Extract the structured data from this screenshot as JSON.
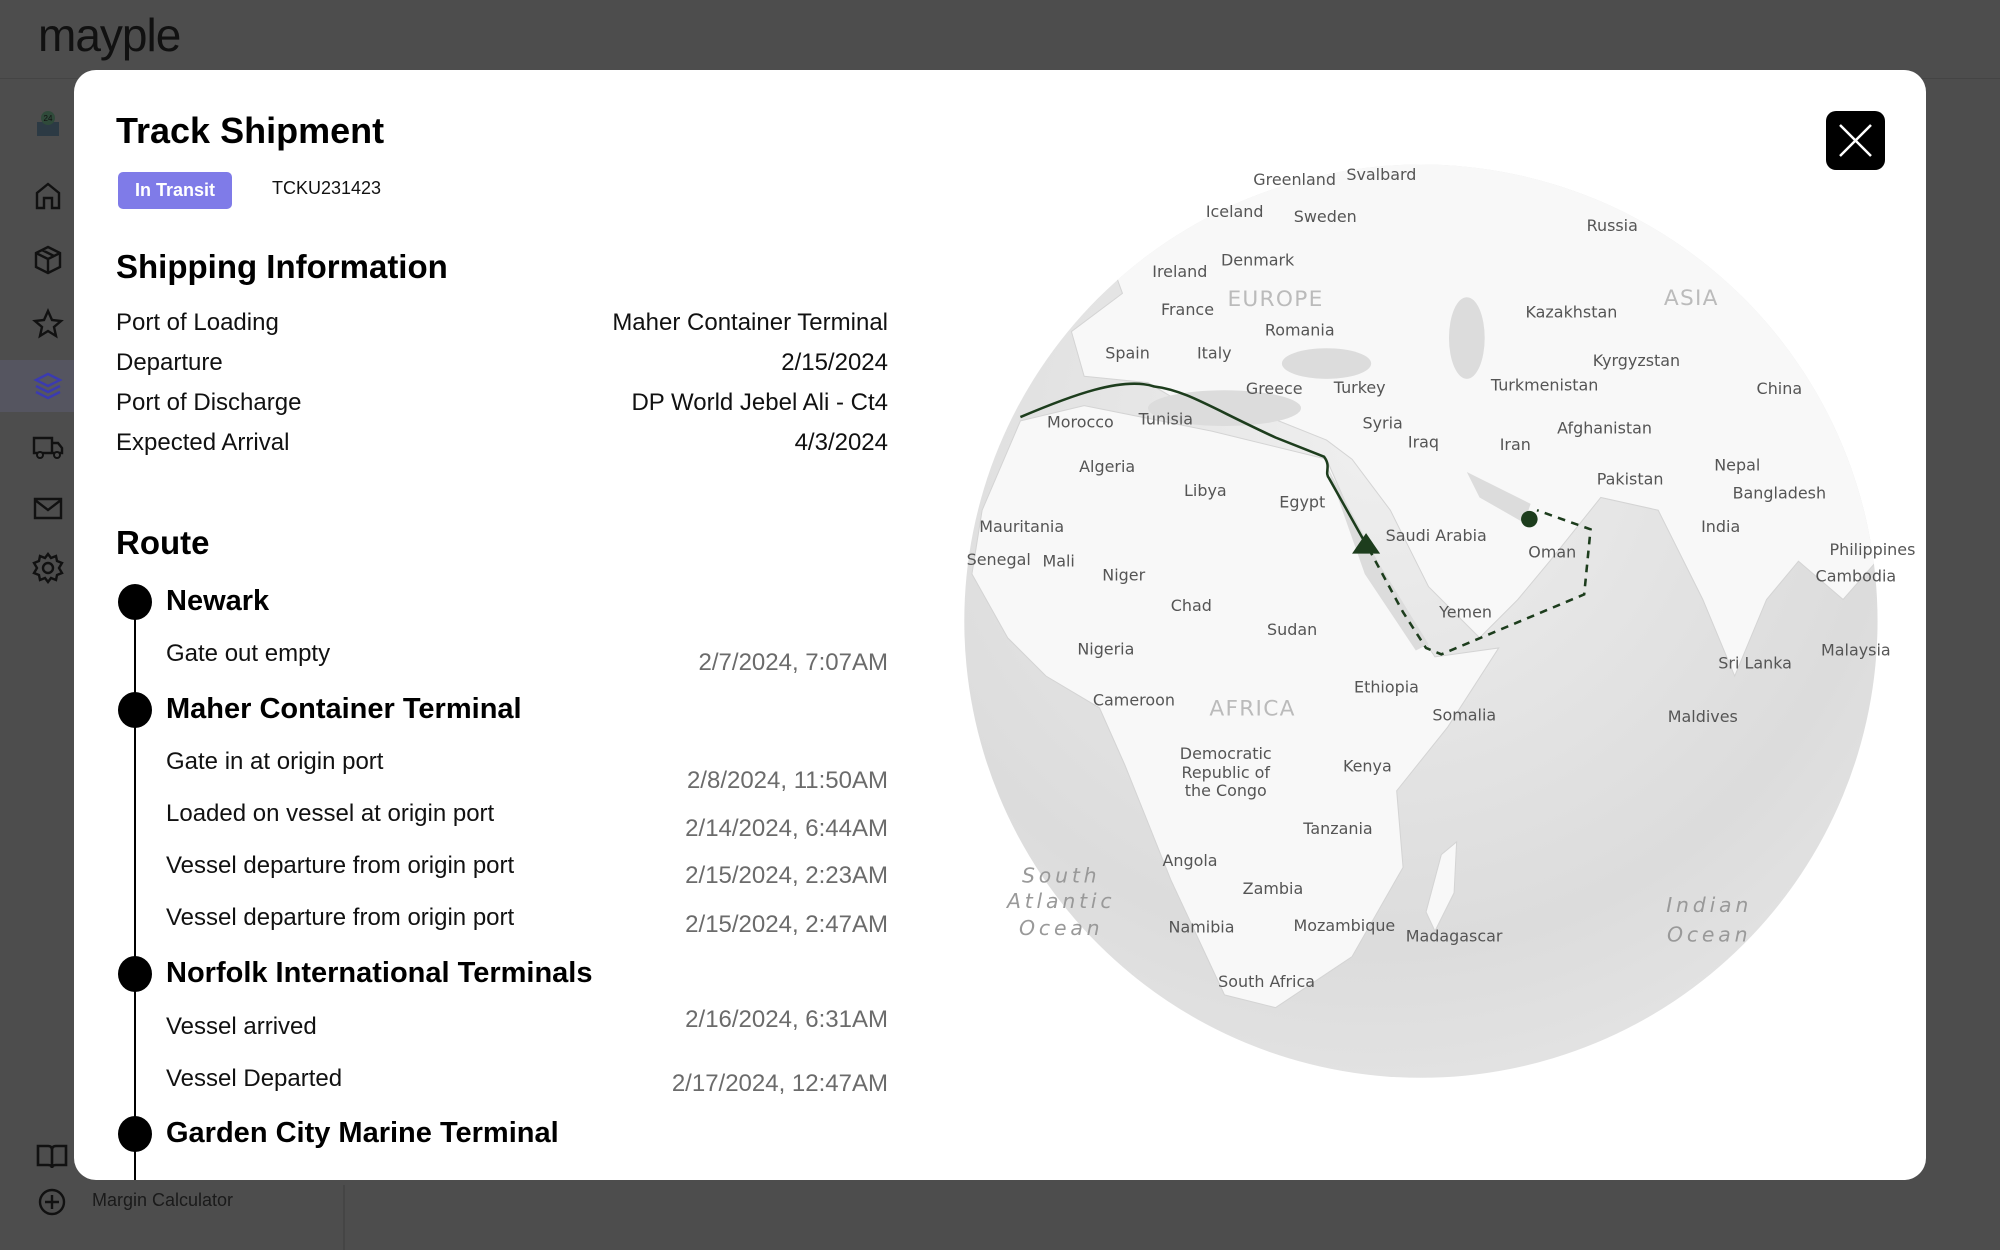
{
  "app": {
    "logo": "mayple"
  },
  "sidebar": {
    "items": [
      {
        "icon": "store-24-icon"
      },
      {
        "icon": "home-icon"
      },
      {
        "icon": "box-icon"
      },
      {
        "icon": "star-icon"
      },
      {
        "icon": "layers-icon",
        "active": true
      },
      {
        "icon": "truck-icon"
      },
      {
        "icon": "mail-icon"
      },
      {
        "icon": "gear-icon"
      }
    ],
    "bottom": [
      {
        "icon": "book-icon"
      },
      {
        "icon": "plus-circle-icon",
        "label": "Margin Calculator"
      }
    ],
    "active_color": "#3b3bb0"
  },
  "modal": {
    "title": "Track Shipment",
    "status_badge": "In Transit",
    "status_color": "#7f7be8",
    "tracking_number": "TCKU231423",
    "shipping_info": {
      "heading": "Shipping Information",
      "rows": [
        {
          "label": "Port of Loading",
          "value": "Maher Container Terminal"
        },
        {
          "label": "Departure",
          "value": "2/15/2024"
        },
        {
          "label": "Port of Discharge",
          "value": "DP World Jebel Ali - Ct4"
        },
        {
          "label": "Expected Arrival",
          "value": "4/3/2024"
        }
      ]
    },
    "route": {
      "heading": "Route",
      "stops": [
        {
          "name": "Newark",
          "events": [
            {
              "label": "Gate out empty",
              "date": "2/7/2024, 7:07AM"
            }
          ]
        },
        {
          "name": "Maher Container Terminal",
          "events": [
            {
              "label": "Gate in at origin port",
              "date": "2/8/2024, 11:50AM"
            },
            {
              "label": "Loaded on vessel at origin port",
              "date": "2/14/2024, 6:44AM"
            },
            {
              "label": "Vessel departure from origin port",
              "date": "2/15/2024, 2:23AM"
            },
            {
              "label": "Vessel departure from origin port",
              "date": "2/15/2024, 2:47AM"
            }
          ]
        },
        {
          "name": "Norfolk International Terminals",
          "events": [
            {
              "label": "Vessel arrived",
              "date": "2/16/2024, 6:31AM"
            },
            {
              "label": "Vessel Departed",
              "date": "2/17/2024, 12:47AM"
            }
          ]
        },
        {
          "name": "Garden City Marine Terminal",
          "events": []
        }
      ]
    },
    "close_icon": "close-icon",
    "map": {
      "route_color": "#1d3d1d",
      "labels": [
        "Greenland",
        "Svalbard",
        "Iceland",
        "Sweden",
        "Russia",
        "Ireland",
        "Denmark",
        "France",
        "Romania",
        "Kazakhstan",
        "Spain",
        "Italy",
        "Kyrgyzstan",
        "Greece",
        "Turkey",
        "Turkmenistan",
        "China",
        "Morocco",
        "Tunisia",
        "Syria",
        "Iraq",
        "Iran",
        "Afghanistan",
        "Algeria",
        "Libya",
        "Egypt",
        "Nepal",
        "Pakistan",
        "Bangladesh",
        "Mauritania",
        "Saudi Arabia",
        "India",
        "Oman",
        "Senegal",
        "Mali",
        "Niger",
        "Philippines",
        "Cambodia",
        "Chad",
        "Yemen",
        "Sudan",
        "Nigeria",
        "Malaysia",
        "Sri Lanka",
        "Ethiopia",
        "Cameroon",
        "Somalia",
        "Maldives",
        "Kenya",
        "Tanzania",
        "Angola",
        "Zambia",
        "Namibia",
        "Mozambique",
        "Madagascar",
        "South Africa"
      ],
      "multiline_labels": {
        "drc": [
          "Democratic",
          "Republic of",
          "the Congo"
        ],
        "south_atlantic": [
          "South",
          "Atlantic",
          "Ocean"
        ],
        "indian_ocean": [
          "Indian",
          "Ocean"
        ]
      },
      "regions": [
        "EUROPE",
        "ASIA",
        "AFRICA"
      ]
    }
  }
}
